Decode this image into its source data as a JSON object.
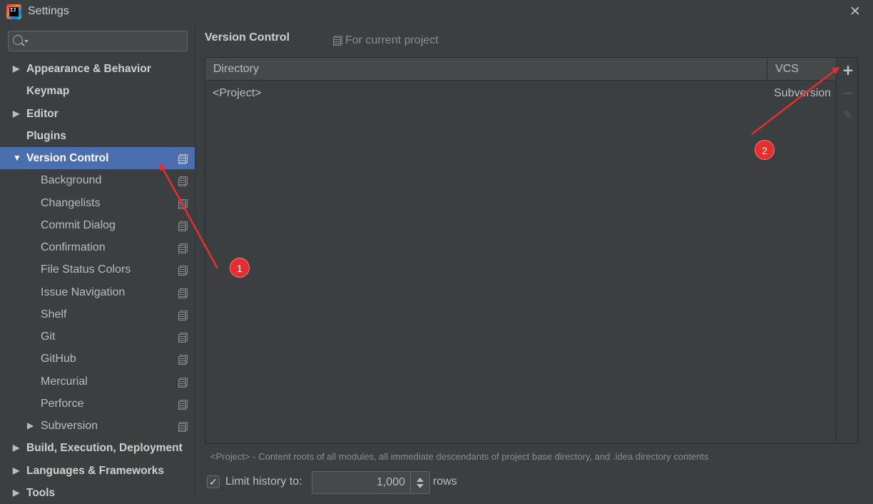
{
  "window": {
    "title": "Settings",
    "logo_text": "IJ",
    "close_glyph": "✕"
  },
  "search": {
    "value": "",
    "placeholder": ""
  },
  "sidebar": {
    "items": [
      {
        "label": "Appearance & Behavior",
        "level": 0,
        "expandable": true,
        "expanded": false,
        "project_icon": false
      },
      {
        "label": "Keymap",
        "level": 0,
        "expandable": false,
        "project_icon": false
      },
      {
        "label": "Editor",
        "level": 0,
        "expandable": true,
        "expanded": false,
        "project_icon": false
      },
      {
        "label": "Plugins",
        "level": 0,
        "expandable": false,
        "project_icon": false
      },
      {
        "label": "Version Control",
        "level": 0,
        "expandable": true,
        "expanded": true,
        "selected": true,
        "project_icon": true
      },
      {
        "label": "Background",
        "level": 1,
        "project_icon": true
      },
      {
        "label": "Changelists",
        "level": 1,
        "project_icon": true
      },
      {
        "label": "Commit Dialog",
        "level": 1,
        "project_icon": true
      },
      {
        "label": "Confirmation",
        "level": 1,
        "project_icon": true
      },
      {
        "label": "File Status Colors",
        "level": 1,
        "project_icon": true
      },
      {
        "label": "Issue Navigation",
        "level": 1,
        "project_icon": true
      },
      {
        "label": "Shelf",
        "level": 1,
        "project_icon": true
      },
      {
        "label": "Git",
        "level": 1,
        "project_icon": true
      },
      {
        "label": "GitHub",
        "level": 1,
        "project_icon": true
      },
      {
        "label": "Mercurial",
        "level": 1,
        "project_icon": true
      },
      {
        "label": "Perforce",
        "level": 1,
        "project_icon": true
      },
      {
        "label": "Subversion",
        "level": 1,
        "expandable": true,
        "expanded": false,
        "project_icon": true
      },
      {
        "label": "Build, Execution, Deployment",
        "level": 0,
        "expandable": true,
        "expanded": false,
        "project_icon": false
      },
      {
        "label": "Languages & Frameworks",
        "level": 0,
        "expandable": true,
        "expanded": false,
        "project_icon": false
      },
      {
        "label": "Tools",
        "level": 0,
        "expandable": true,
        "expanded": false,
        "project_icon": false
      }
    ]
  },
  "main": {
    "title": "Version Control",
    "scope_label": "For current project",
    "table": {
      "columns": [
        "Directory",
        "VCS"
      ],
      "rows": [
        {
          "directory": "<Project>",
          "vcs": "Subversion"
        }
      ]
    },
    "toolbar": {
      "add": "+",
      "remove": "−",
      "edit": "✎"
    },
    "footnote": "<Project> - Content roots of all modules, all immediate descendants of project base directory, and .idea directory contents",
    "limit_history": {
      "checked": true,
      "check_glyph": "✓",
      "label": "Limit history to:",
      "value": "1,000",
      "unit": "rows"
    }
  },
  "annotations": {
    "badge_1": "1",
    "badge_2": "2",
    "color": "#e62e2e"
  },
  "colors": {
    "background": "#3c3f41",
    "selection": "#4b6eaf",
    "header": "#45494a",
    "text": "#bbbbbb"
  }
}
